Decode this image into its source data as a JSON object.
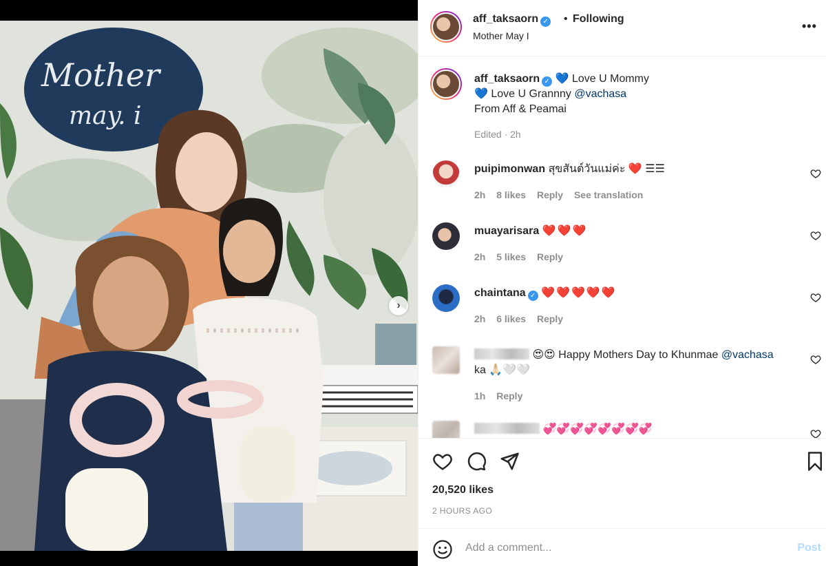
{
  "post": {
    "username": "aff_taksaorn",
    "follow_state": "Following",
    "location": "Mother May I",
    "separator": "•",
    "more_label": "•••",
    "caption": {
      "line1": "Love U Mommy",
      "line2_prefix": "Love U Grannny",
      "mention": "@vachasa",
      "line3": "From Aff & Peamai",
      "edited": "Edited · 2h",
      "heart": "💙"
    },
    "sign_text": "Mother may. i",
    "image_count": 7,
    "active_image": 0,
    "likes": "20,520 likes",
    "posted_time": "2 HOURS AGO",
    "next_arrow": "›"
  },
  "comments": [
    {
      "username": "puipimonwan",
      "text": "สุขสันต์วันแม่ค่ะ ❤️ ☰☰",
      "time": "2h",
      "likes": "8 likes",
      "reply": "Reply",
      "translate": "See translation"
    },
    {
      "username": "muayarisara",
      "text": "❤️❤️❤️",
      "time": "2h",
      "likes": "5 likes",
      "reply": "Reply"
    },
    {
      "username": "chaintana",
      "text": "❤️❤️❤️❤️❤️",
      "time": "2h",
      "likes": "6 likes",
      "reply": "Reply"
    },
    {
      "username": "",
      "text_prefix": "😍😍",
      "text": "Happy Mothers Day to Khunmae",
      "mention": "@vachasa",
      "text2": "ka 🙏🏻🤍🤍",
      "time": "1h",
      "reply": "Reply"
    },
    {
      "username": "",
      "text": "💞💞💞💞💞💞💞💞"
    }
  ],
  "add_comment": {
    "placeholder": "Add a comment...",
    "post_label": "Post"
  },
  "icons": {
    "like": "heart-icon",
    "comment": "comment-bubble-icon",
    "share": "paper-plane-icon",
    "save": "bookmark-icon",
    "emoji": "smiley-icon",
    "more": "more-options-icon"
  },
  "colors": {
    "verified": "#3897f0",
    "link": "#00376b",
    "muted": "#8e8e8e",
    "post_disabled": "#b3dbff"
  }
}
